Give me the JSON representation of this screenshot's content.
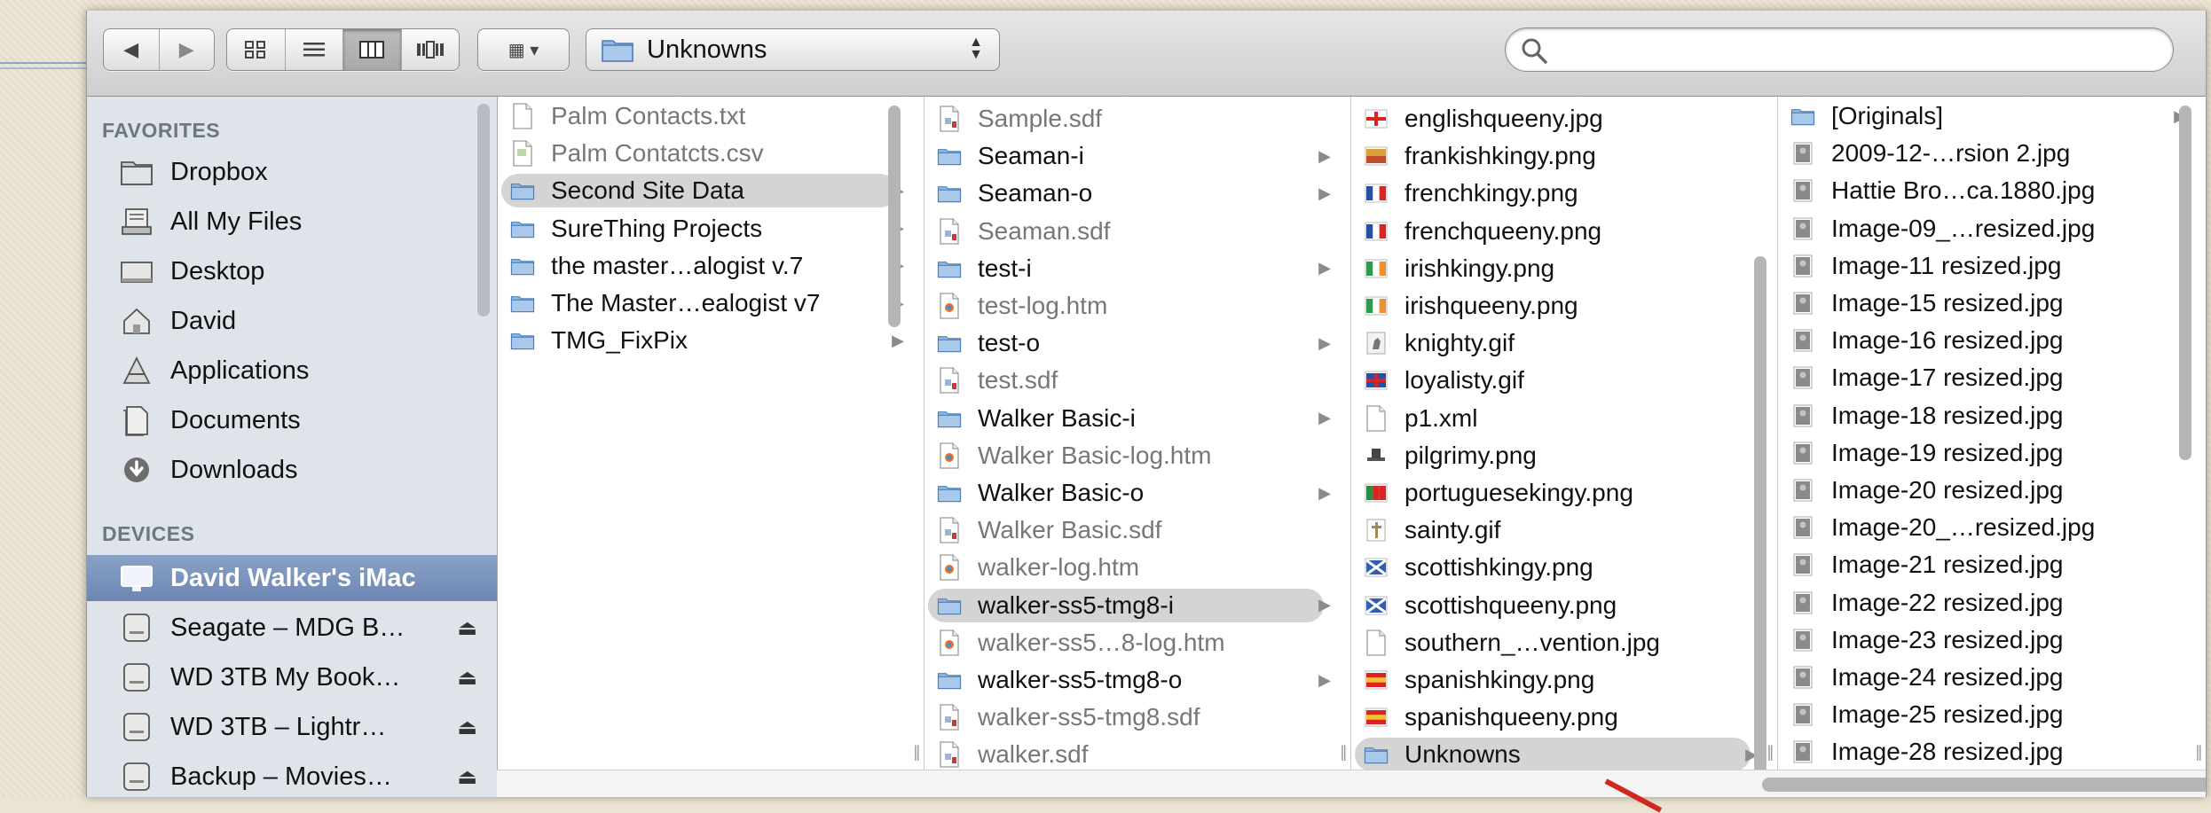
{
  "window": {
    "path_popup": "Unknowns",
    "search_placeholder": ""
  },
  "toolbar": {
    "nav": [
      "◀",
      "▶"
    ],
    "views": [
      "icon-view",
      "list-view",
      "column-view",
      "coverflow-view"
    ],
    "arrange": "▦ ▾"
  },
  "sidebar": {
    "favorites_header": "FAVORITES",
    "favorites": [
      {
        "label": "Dropbox",
        "icon": "folder-icon"
      },
      {
        "label": "All My Files",
        "icon": "all-files-icon"
      },
      {
        "label": "Desktop",
        "icon": "desktop-icon"
      },
      {
        "label": "David",
        "icon": "home-icon"
      },
      {
        "label": "Applications",
        "icon": "applications-icon"
      },
      {
        "label": "Documents",
        "icon": "documents-icon"
      },
      {
        "label": "Downloads",
        "icon": "downloads-icon"
      }
    ],
    "devices_header": "DEVICES",
    "devices": [
      {
        "label": "David Walker's iMac",
        "icon": "imac-icon",
        "selected": true
      },
      {
        "label": "Seagate – MDG B…",
        "icon": "drive-icon",
        "eject": "⏏"
      },
      {
        "label": "WD 3TB My Book…",
        "icon": "drive-icon",
        "eject": "⏏"
      },
      {
        "label": "WD 3TB – Lightr…",
        "icon": "drive-icon",
        "eject": "⏏"
      },
      {
        "label": "Backup – Movies…",
        "icon": "drive-icon",
        "eject": "⏏"
      }
    ]
  },
  "columns": [
    {
      "items": [
        {
          "label": "Palm Contacts.txt",
          "kind": "file",
          "icon": "text-file-icon"
        },
        {
          "label": "Palm Contatcts.csv",
          "kind": "file",
          "icon": "csv-file-icon"
        },
        {
          "label": "Second Site Data",
          "kind": "folder",
          "selected": true
        },
        {
          "label": "SureThing Projects",
          "kind": "folder"
        },
        {
          "label": "the master…alogist v.7",
          "kind": "folder"
        },
        {
          "label": "The Master…ealogist v7",
          "kind": "folder"
        },
        {
          "label": "TMG_FixPix",
          "kind": "folder"
        }
      ]
    },
    {
      "items": [
        {
          "label": "Sample.sdf",
          "kind": "file",
          "icon": "sdf-file-icon"
        },
        {
          "label": "Seaman-i",
          "kind": "folder"
        },
        {
          "label": "Seaman-o",
          "kind": "folder"
        },
        {
          "label": "Seaman.sdf",
          "kind": "file",
          "icon": "sdf-file-icon"
        },
        {
          "label": "test-i",
          "kind": "folder"
        },
        {
          "label": "test-log.htm",
          "kind": "file",
          "icon": "htm-file-icon"
        },
        {
          "label": "test-o",
          "kind": "folder"
        },
        {
          "label": "test.sdf",
          "kind": "file",
          "icon": "sdf-file-icon"
        },
        {
          "label": "Walker Basic-i",
          "kind": "folder"
        },
        {
          "label": "Walker Basic-log.htm",
          "kind": "file",
          "icon": "htm-file-icon"
        },
        {
          "label": "Walker Basic-o",
          "kind": "folder"
        },
        {
          "label": "Walker Basic.sdf",
          "kind": "file",
          "icon": "sdf-file-icon"
        },
        {
          "label": "walker-log.htm",
          "kind": "file",
          "icon": "htm-file-icon"
        },
        {
          "label": "walker-ss5-tmg8-i",
          "kind": "folder",
          "selected": true
        },
        {
          "label": "walker-ss5…8-log.htm",
          "kind": "file",
          "icon": "htm-file-icon"
        },
        {
          "label": "walker-ss5-tmg8-o",
          "kind": "folder"
        },
        {
          "label": "walker-ss5-tmg8.sdf",
          "kind": "file",
          "icon": "sdf-file-icon"
        },
        {
          "label": "walker.sdf",
          "kind": "file",
          "icon": "sdf-file-icon"
        }
      ]
    },
    {
      "items": [
        {
          "label": "englishqueeny.jpg",
          "kind": "image",
          "icon": "flag-england-icon"
        },
        {
          "label": "frankishkingy.png",
          "kind": "image",
          "icon": "flag-image-icon"
        },
        {
          "label": "frenchkingy.png",
          "kind": "image",
          "icon": "flag-france-icon"
        },
        {
          "label": "frenchqueeny.png",
          "kind": "image",
          "icon": "flag-france-icon"
        },
        {
          "label": "irishkingy.png",
          "kind": "image",
          "icon": "flag-ireland-icon"
        },
        {
          "label": "irishqueeny.png",
          "kind": "image",
          "icon": "flag-ireland-icon"
        },
        {
          "label": "knighty.gif",
          "kind": "image",
          "icon": "knight-icon"
        },
        {
          "label": "loyalisty.gif",
          "kind": "image",
          "icon": "flag-uk-icon"
        },
        {
          "label": "p1.xml",
          "kind": "image",
          "icon": "xml-file-icon"
        },
        {
          "label": "pilgrimy.png",
          "kind": "image",
          "icon": "pilgrim-icon"
        },
        {
          "label": "portuguesekingy.png",
          "kind": "image",
          "icon": "flag-portugal-icon"
        },
        {
          "label": "sainty.gif",
          "kind": "image",
          "icon": "cross-icon"
        },
        {
          "label": "scottishkingy.png",
          "kind": "image",
          "icon": "flag-scotland-icon"
        },
        {
          "label": "scottishqueeny.png",
          "kind": "image",
          "icon": "flag-scotland-icon"
        },
        {
          "label": "southern_…vention.jpg",
          "kind": "image",
          "icon": "image-file-icon"
        },
        {
          "label": "spanishkingy.png",
          "kind": "image",
          "icon": "flag-spain-icon"
        },
        {
          "label": "spanishqueeny.png",
          "kind": "image",
          "icon": "flag-spain-icon"
        },
        {
          "label": "Unknowns",
          "kind": "folder",
          "selected": true
        }
      ]
    },
    {
      "items": [
        {
          "label": "[Originals]",
          "kind": "folder"
        },
        {
          "label": "2009-12-…rsion 2.jpg",
          "kind": "image",
          "icon": "photo-thumb-icon"
        },
        {
          "label": "Hattie Bro…ca.1880.jpg",
          "kind": "image",
          "icon": "photo-thumb-icon"
        },
        {
          "label": "Image-09_…resized.jpg",
          "kind": "image",
          "icon": "photo-thumb-icon"
        },
        {
          "label": "Image-11 resized.jpg",
          "kind": "image",
          "icon": "photo-thumb-icon"
        },
        {
          "label": "Image-15 resized.jpg",
          "kind": "image",
          "icon": "photo-thumb-icon"
        },
        {
          "label": "Image-16 resized.jpg",
          "kind": "image",
          "icon": "photo-thumb-icon"
        },
        {
          "label": "Image-17 resized.jpg",
          "kind": "image",
          "icon": "photo-thumb-icon"
        },
        {
          "label": "Image-18 resized.jpg",
          "kind": "image",
          "icon": "photo-thumb-icon"
        },
        {
          "label": "Image-19 resized.jpg",
          "kind": "image",
          "icon": "photo-thumb-icon"
        },
        {
          "label": "Image-20 resized.jpg",
          "kind": "image",
          "icon": "photo-thumb-icon"
        },
        {
          "label": "Image-20_…resized.jpg",
          "kind": "image",
          "icon": "photo-thumb-icon"
        },
        {
          "label": "Image-21 resized.jpg",
          "kind": "image",
          "icon": "photo-thumb-icon"
        },
        {
          "label": "Image-22 resized.jpg",
          "kind": "image",
          "icon": "photo-thumb-icon"
        },
        {
          "label": "Image-23 resized.jpg",
          "kind": "image",
          "icon": "photo-thumb-icon"
        },
        {
          "label": "Image-24 resized.jpg",
          "kind": "image",
          "icon": "photo-thumb-icon"
        },
        {
          "label": "Image-25 resized.jpg",
          "kind": "image",
          "icon": "photo-thumb-icon"
        },
        {
          "label": "Image-28 resized.jpg",
          "kind": "image",
          "icon": "photo-thumb-icon"
        }
      ]
    }
  ],
  "colors": {
    "folder": "#7ea9d8",
    "selected_sidebar": "#7b93bd",
    "selection_pill": "#d4d4d4",
    "arrow": "#d0281e"
  }
}
